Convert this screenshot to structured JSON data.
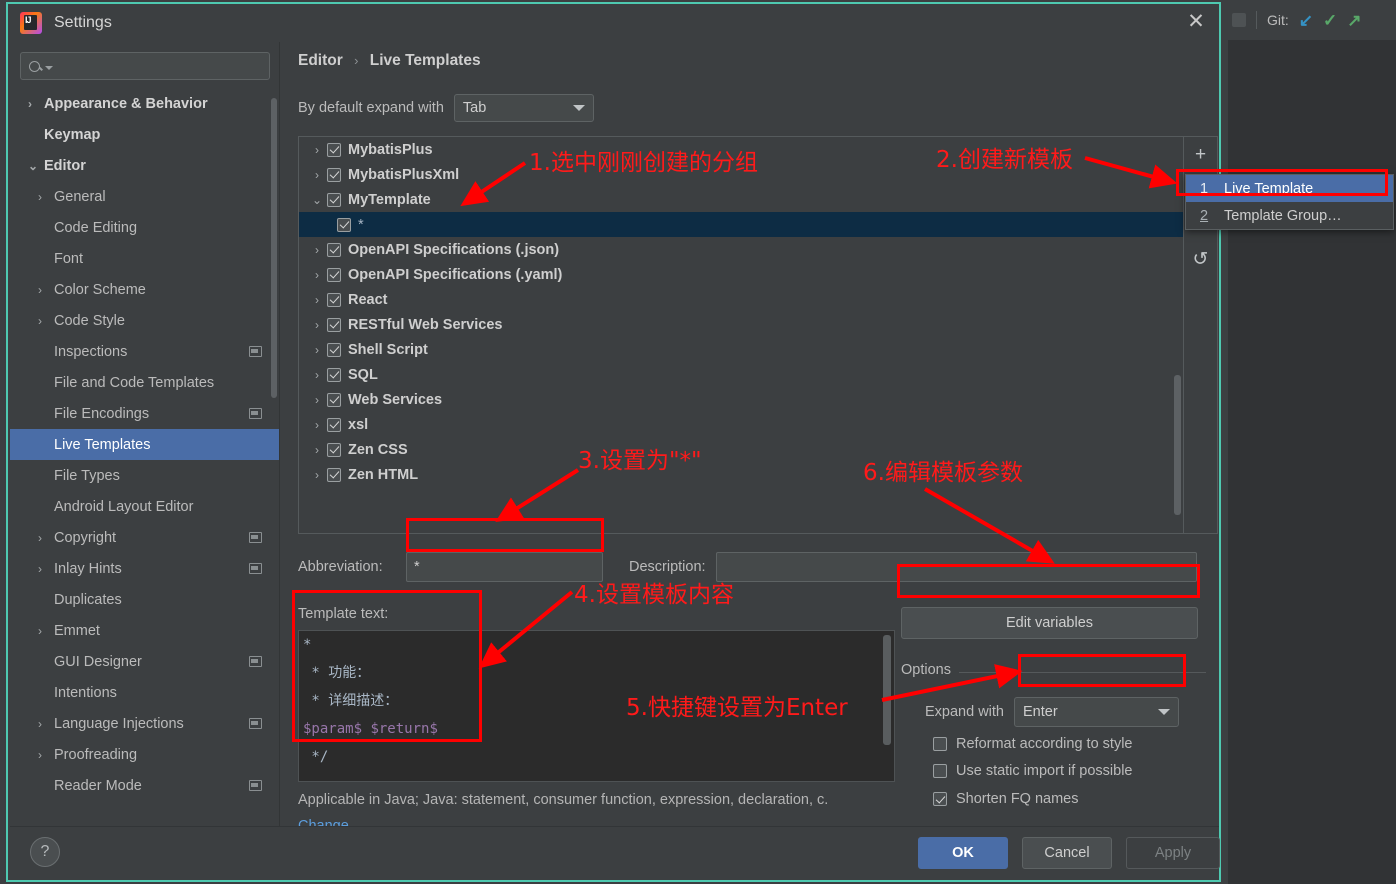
{
  "ide": {
    "git_label": "Git:",
    "git_icons": [
      "update-project-icon",
      "commit-icon",
      "push-icon"
    ]
  },
  "dialog": {
    "title": "Settings",
    "close_label": "✕",
    "app_icon": "intellij-idea-icon"
  },
  "search": {
    "placeholder": "",
    "value": "",
    "icon": "search-icon"
  },
  "sidebar": {
    "items": [
      {
        "label": "Appearance & Behavior",
        "arrow": "›",
        "bold": true,
        "badge": false,
        "selected": false
      },
      {
        "label": "Keymap",
        "arrow": "",
        "bold": true,
        "badge": false,
        "selected": false
      },
      {
        "label": "Editor",
        "arrow": "⌄",
        "bold": true,
        "badge": false,
        "selected": false
      },
      {
        "label": "General",
        "arrow": "›",
        "bold": false,
        "badge": false,
        "selected": false,
        "indent": 1
      },
      {
        "label": "Code Editing",
        "arrow": "",
        "bold": false,
        "badge": false,
        "selected": false,
        "indent": 1
      },
      {
        "label": "Font",
        "arrow": "",
        "bold": false,
        "badge": false,
        "selected": false,
        "indent": 1
      },
      {
        "label": "Color Scheme",
        "arrow": "›",
        "bold": false,
        "badge": false,
        "selected": false,
        "indent": 1
      },
      {
        "label": "Code Style",
        "arrow": "›",
        "bold": false,
        "badge": false,
        "selected": false,
        "indent": 1
      },
      {
        "label": "Inspections",
        "arrow": "",
        "bold": false,
        "badge": true,
        "selected": false,
        "indent": 1
      },
      {
        "label": "File and Code Templates",
        "arrow": "",
        "bold": false,
        "badge": false,
        "selected": false,
        "indent": 1
      },
      {
        "label": "File Encodings",
        "arrow": "",
        "bold": false,
        "badge": true,
        "selected": false,
        "indent": 1
      },
      {
        "label": "Live Templates",
        "arrow": "",
        "bold": false,
        "badge": false,
        "selected": true,
        "indent": 1
      },
      {
        "label": "File Types",
        "arrow": "",
        "bold": false,
        "badge": false,
        "selected": false,
        "indent": 1
      },
      {
        "label": "Android Layout Editor",
        "arrow": "",
        "bold": false,
        "badge": false,
        "selected": false,
        "indent": 1
      },
      {
        "label": "Copyright",
        "arrow": "›",
        "bold": false,
        "badge": true,
        "selected": false,
        "indent": 1
      },
      {
        "label": "Inlay Hints",
        "arrow": "›",
        "bold": false,
        "badge": true,
        "selected": false,
        "indent": 1
      },
      {
        "label": "Duplicates",
        "arrow": "",
        "bold": false,
        "badge": false,
        "selected": false,
        "indent": 1
      },
      {
        "label": "Emmet",
        "arrow": "›",
        "bold": false,
        "badge": false,
        "selected": false,
        "indent": 1
      },
      {
        "label": "GUI Designer",
        "arrow": "",
        "bold": false,
        "badge": true,
        "selected": false,
        "indent": 1
      },
      {
        "label": "Intentions",
        "arrow": "",
        "bold": false,
        "badge": false,
        "selected": false,
        "indent": 1
      },
      {
        "label": "Language Injections",
        "arrow": "›",
        "bold": false,
        "badge": true,
        "selected": false,
        "indent": 1
      },
      {
        "label": "Proofreading",
        "arrow": "›",
        "bold": false,
        "badge": false,
        "selected": false,
        "indent": 1
      },
      {
        "label": "Reader Mode",
        "arrow": "",
        "bold": false,
        "badge": true,
        "selected": false,
        "indent": 1
      }
    ]
  },
  "breadcrumb": {
    "parent": "Editor",
    "separator": "›",
    "current": "Live Templates"
  },
  "expand_default": {
    "label": "By default expand with",
    "value": "Tab"
  },
  "template_tree": {
    "rows": [
      {
        "label": "MybatisPlus",
        "arrow": "›",
        "checked": true,
        "child": false,
        "selected": false
      },
      {
        "label": "MybatisPlusXml",
        "arrow": "›",
        "checked": true,
        "child": false,
        "selected": false
      },
      {
        "label": "MyTemplate",
        "arrow": "⌄",
        "checked": true,
        "child": false,
        "selected": false
      },
      {
        "label": "*",
        "arrow": "",
        "checked": true,
        "child": true,
        "selected": true
      },
      {
        "label": "OpenAPI Specifications (.json)",
        "arrow": "›",
        "checked": true,
        "child": false,
        "selected": false
      },
      {
        "label": "OpenAPI Specifications (.yaml)",
        "arrow": "›",
        "checked": true,
        "child": false,
        "selected": false
      },
      {
        "label": "React",
        "arrow": "›",
        "checked": true,
        "child": false,
        "selected": false
      },
      {
        "label": "RESTful Web Services",
        "arrow": "›",
        "checked": true,
        "child": false,
        "selected": false
      },
      {
        "label": "Shell Script",
        "arrow": "›",
        "checked": true,
        "child": false,
        "selected": false
      },
      {
        "label": "SQL",
        "arrow": "›",
        "checked": true,
        "child": false,
        "selected": false
      },
      {
        "label": "Web Services",
        "arrow": "›",
        "checked": true,
        "child": false,
        "selected": false
      },
      {
        "label": "xsl",
        "arrow": "›",
        "checked": true,
        "child": false,
        "selected": false
      },
      {
        "label": "Zen CSS",
        "arrow": "›",
        "checked": true,
        "child": false,
        "selected": false
      },
      {
        "label": "Zen HTML",
        "arrow": "›",
        "checked": true,
        "child": false,
        "selected": false
      }
    ],
    "toolbar": {
      "add": "+",
      "remove": "–",
      "revert": "↺"
    }
  },
  "add_menu": {
    "items": [
      {
        "num": "1",
        "label": "Live Template",
        "selected": true
      },
      {
        "num": "2",
        "label": "Template Group…",
        "selected": false
      }
    ]
  },
  "form": {
    "abbreviation_label": "Abbreviation:",
    "abbreviation_value": "*",
    "description_label": "Description:",
    "description_value": "",
    "template_text_label": "Template text:",
    "template_lines": [
      "*",
      " * 功能：",
      " * 详细描述：",
      "$param$ $return$",
      " */"
    ],
    "applicable_text": "Applicable in Java; Java: statement, consumer function, expression, declaration, c.",
    "change_link": "Change",
    "change_caret": "⌄"
  },
  "options": {
    "edit_variables_label": "Edit variables",
    "title": "Options",
    "expand_with_label": "Expand with",
    "expand_with_value": "Enter",
    "checkboxes": [
      {
        "label": "Reformat according to style",
        "checked": false
      },
      {
        "label": "Use static import if possible",
        "checked": false
      },
      {
        "label": "Shorten FQ names",
        "checked": true
      }
    ]
  },
  "footer": {
    "help": "?",
    "ok": "OK",
    "cancel": "Cancel",
    "apply": "Apply"
  },
  "annotations": [
    {
      "id": "a1",
      "text": "1.选中刚刚创建的分组"
    },
    {
      "id": "a2",
      "text": "2.创建新模板"
    },
    {
      "id": "a3",
      "text": "3.设置为\"*\""
    },
    {
      "id": "a4",
      "text": "4.设置模板内容"
    },
    {
      "id": "a5",
      "text": "5.快捷键设置为Enter"
    },
    {
      "id": "a6",
      "text": "6.编辑模板参数"
    }
  ],
  "colors": {
    "accent_blue": "#4a6da7",
    "annotation_red": "#ff0000",
    "dialog_bg": "#3c3f41",
    "editor_bg": "#2b2b2b",
    "border_teal": "#4ec9b0",
    "link_blue": "#5c9ede"
  }
}
